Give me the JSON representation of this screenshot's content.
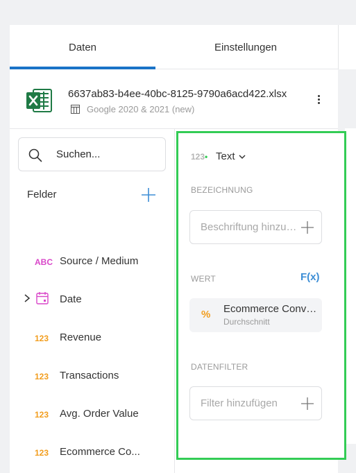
{
  "tabs": [
    {
      "label": "Daten",
      "active": true
    },
    {
      "label": "Einstellungen",
      "active": false
    }
  ],
  "file": {
    "name": "6637ab83-b4ee-40bc-8125-9790a6acd422.xlsx",
    "sheet": "Google 2020 & 2021 (new)",
    "icon": "excel-icon"
  },
  "search": {
    "placeholder": "Suchen..."
  },
  "fields_header": "Felder",
  "fields": [
    {
      "type": "ABC",
      "label": "Source / Medium"
    },
    {
      "type": "date",
      "label": "Date"
    },
    {
      "type": "123",
      "label": "Revenue"
    },
    {
      "type": "123",
      "label": "Transactions"
    },
    {
      "type": "123",
      "label": "Avg. Order Value"
    },
    {
      "type": "123",
      "label": "Ecommerce Co..."
    }
  ],
  "config": {
    "type_prefix": "123",
    "type_dot": "•",
    "type_label": "Text",
    "label_section": "BEZEICHNUNG",
    "label_placeholder": "Beschriftung hinzufügen",
    "value_section": "WERT",
    "fx_label": "F(x)",
    "value_symbol": "%",
    "value_name": "Ecommerce Conversion Rate",
    "value_aggregation": "Durchschnitt",
    "filter_section": "DATENFILTER",
    "filter_placeholder": "Filter hinzufügen"
  },
  "colors": {
    "accent": "#1a73c7",
    "highlight_frame": "#33cc55",
    "text_type": "#d946c9",
    "number_type": "#f29d1d",
    "fx": "#3d8ed6"
  }
}
